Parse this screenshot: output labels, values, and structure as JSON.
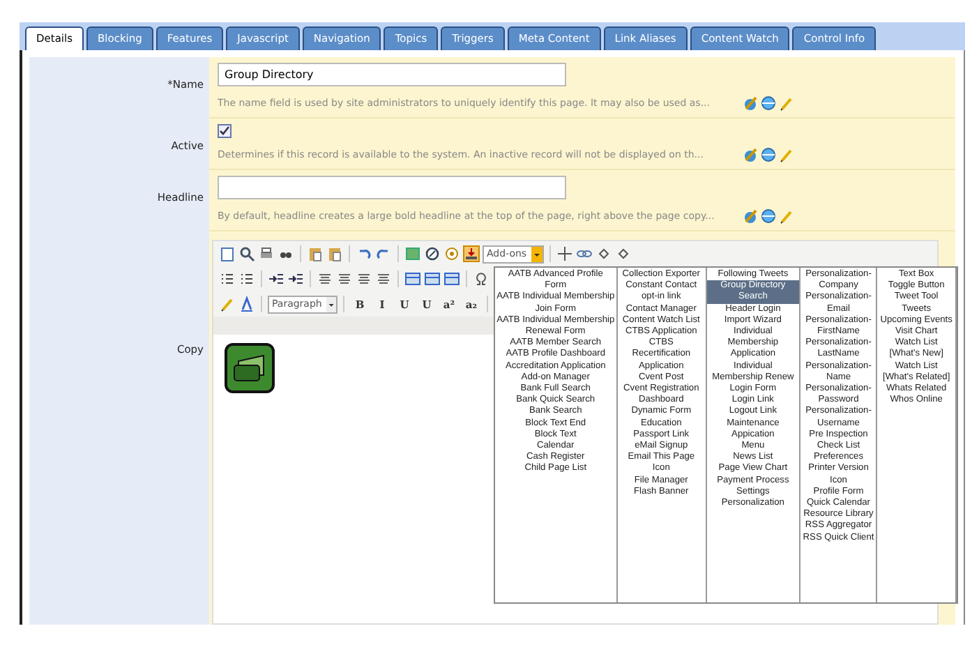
{
  "tabs": [
    {
      "label": "Details",
      "selected": true
    },
    {
      "label": "Blocking",
      "selected": false
    },
    {
      "label": "Features",
      "selected": false
    },
    {
      "label": "Javascript",
      "selected": false
    },
    {
      "label": "Navigation",
      "selected": false
    },
    {
      "label": "Topics",
      "selected": false
    },
    {
      "label": "Triggers",
      "selected": false
    },
    {
      "label": "Meta Content",
      "selected": false
    },
    {
      "label": "Link Aliases",
      "selected": false
    },
    {
      "label": "Content Watch",
      "selected": false
    },
    {
      "label": "Control Info",
      "selected": false
    }
  ],
  "fields": [
    {
      "kind": "text",
      "label": "*Name",
      "value": "Group Directory",
      "hint": "The name field is used by site administrators to uniquely identify this page. It may also be used as..."
    },
    {
      "kind": "checkbox",
      "label": "Active",
      "checked": true,
      "hint": "Determines if this record is available to the system. An inactive record will not be displayed on th..."
    },
    {
      "kind": "text",
      "label": "Headline",
      "hint": "By default, headline creates a large bold headline at the top of the page, right above the page copy..."
    }
  ],
  "copy": {
    "label": "Copy",
    "addons_select": "Add-ons",
    "format_select": "Paragraph",
    "format_buttons": [
      "B",
      "I",
      "U",
      "U",
      "a²",
      "a₂"
    ],
    "addons_menu": [
      [
        {
          "label": "AATB Advanced Profile Form",
          "selected": false
        },
        {
          "label": "AATB Individual Membership Join Form",
          "selected": false
        },
        {
          "label": "AATB Individual Membership Renewal Form",
          "selected": false
        },
        {
          "label": "AATB Member Search",
          "selected": false
        },
        {
          "label": "AATB Profile Dashboard",
          "selected": false
        },
        {
          "label": "Accreditation Application",
          "selected": false
        },
        {
          "label": "Add-on Manager",
          "selected": false
        },
        {
          "label": "Bank Full Search",
          "selected": false
        },
        {
          "label": "Bank Quick Search",
          "selected": false
        },
        {
          "label": "Bank Search",
          "selected": false
        },
        {
          "label": "Block Text End",
          "selected": false
        },
        {
          "label": "Block Text",
          "selected": false
        },
        {
          "label": "Calendar",
          "selected": false
        },
        {
          "label": "Cash Register",
          "selected": false
        },
        {
          "label": "Child Page List",
          "selected": false
        }
      ],
      [
        {
          "label": "Collection Exporter",
          "selected": false
        },
        {
          "label": "Constant Contact opt-in link",
          "selected": false
        },
        {
          "label": "Contact Manager",
          "selected": false
        },
        {
          "label": "Content Watch List",
          "selected": false
        },
        {
          "label": "CTBS Application",
          "selected": false
        },
        {
          "label": "CTBS Recertification Application",
          "selected": false
        },
        {
          "label": "Cvent Post",
          "selected": false
        },
        {
          "label": "Cvent Registration",
          "selected": false
        },
        {
          "label": "Dashboard",
          "selected": false
        },
        {
          "label": "Dynamic Form",
          "selected": false
        },
        {
          "label": "Education",
          "selected": false
        },
        {
          "label": "Passport Link",
          "selected": false
        },
        {
          "label": "eMail Signup",
          "selected": false
        },
        {
          "label": "Email This Page Icon",
          "selected": false
        },
        {
          "label": "File Manager",
          "selected": false
        },
        {
          "label": "Flash Banner",
          "selected": false
        }
      ],
      [
        {
          "label": "Following Tweets",
          "selected": false
        },
        {
          "label": "Group Directory Search",
          "selected": true
        },
        {
          "label": "Header Login",
          "selected": false
        },
        {
          "label": "Import Wizard",
          "selected": false
        },
        {
          "label": "Individual Membership Application",
          "selected": false
        },
        {
          "label": "Individual Membership Renew",
          "selected": false
        },
        {
          "label": "Login Form",
          "selected": false
        },
        {
          "label": "Login Link",
          "selected": false
        },
        {
          "label": "Logout Link",
          "selected": false
        },
        {
          "label": "Maintenance Appication",
          "selected": false
        },
        {
          "label": "Menu",
          "selected": false
        },
        {
          "label": "News List",
          "selected": false
        },
        {
          "label": "Page View Chart",
          "selected": false
        },
        {
          "label": "Payment Process Settings",
          "selected": false
        },
        {
          "label": "Personalization",
          "selected": false
        }
      ],
      [
        {
          "label": "Personalization-Company",
          "selected": false
        },
        {
          "label": "Personalization-Email",
          "selected": false
        },
        {
          "label": "Personalization-FirstName",
          "selected": false
        },
        {
          "label": "Personalization-LastName",
          "selected": false
        },
        {
          "label": "Personalization-Name",
          "selected": false
        },
        {
          "label": "Personalization-Password",
          "selected": false
        },
        {
          "label": "Personalization-Username",
          "selected": false
        },
        {
          "label": "Pre Inspection Check List",
          "selected": false
        },
        {
          "label": "Preferences",
          "selected": false
        },
        {
          "label": "Printer Version Icon",
          "selected": false
        },
        {
          "label": "Profile Form",
          "selected": false
        },
        {
          "label": "Quick Calendar",
          "selected": false
        },
        {
          "label": "Resource Library",
          "selected": false
        },
        {
          "label": "RSS Aggregator",
          "selected": false
        },
        {
          "label": "RSS Quick Client",
          "selected": false
        }
      ],
      [
        {
          "label": "Text Box",
          "selected": false
        },
        {
          "label": "Toggle Button",
          "selected": false
        },
        {
          "label": "Tweet Tool",
          "selected": false
        },
        {
          "label": "Tweets",
          "selected": false
        },
        {
          "label": "Upcoming Events",
          "selected": false
        },
        {
          "label": "Visit Chart",
          "selected": false
        },
        {
          "label": "Watch List [What's New]",
          "selected": false
        },
        {
          "label": "Watch List [What's Related]",
          "selected": false
        },
        {
          "label": "Whats Related",
          "selected": false
        },
        {
          "label": "Whos Online",
          "selected": false
        }
      ]
    ]
  }
}
